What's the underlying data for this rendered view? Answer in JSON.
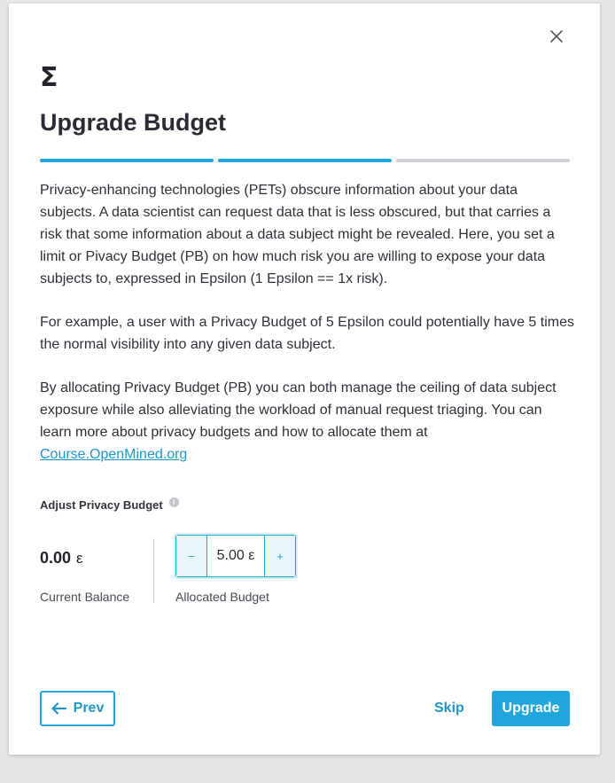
{
  "modal": {
    "logo_symbol": "Σ",
    "title": "Upgrade Budget",
    "close_icon": "close-icon",
    "steps": {
      "total": 3,
      "completed": 2
    },
    "paragraphs": [
      "Privacy-enhancing technologies (PETs) obscure information about your data subjects. A data scientist can request data that is less obscured, but that carries a risk that some information about a data subject might be revealed. Here, you set a limit or Pivacy Budget (PB) on how much risk you are willing to expose your data subjects to, expressed in Epsilon (1 Epsilon == 1x risk).",
      "For example, a user with a Privacy Budget of 5 Epsilon could potentially have 5 times the normal visibility into any given data subject.",
      "By allocating Privacy Budget (PB) you can both manage the ceiling of data subject exposure while also alleviating the workload of manual request triaging. You can learn more about privacy budgets and how to allocate them at"
    ],
    "link_text": "Course.OpenMined.org",
    "adjust": {
      "label": "Adjust Privacy Budget",
      "info_icon": "info-icon",
      "current_balance_value": "0.00",
      "unit": "ε",
      "current_balance_label": "Current Balance",
      "stepper_minus": "−",
      "stepper_value": "5.00 ε",
      "stepper_plus": "+",
      "allocated_label": "Allocated Budget"
    },
    "footer": {
      "prev_icon": "arrow-left-icon",
      "prev_label": "Prev",
      "skip_label": "Skip",
      "upgrade_label": "Upgrade"
    }
  },
  "colors": {
    "accent": "#20a6dc",
    "progress_inactive": "#cfd0d6",
    "backdrop": "#e7e7e9"
  }
}
